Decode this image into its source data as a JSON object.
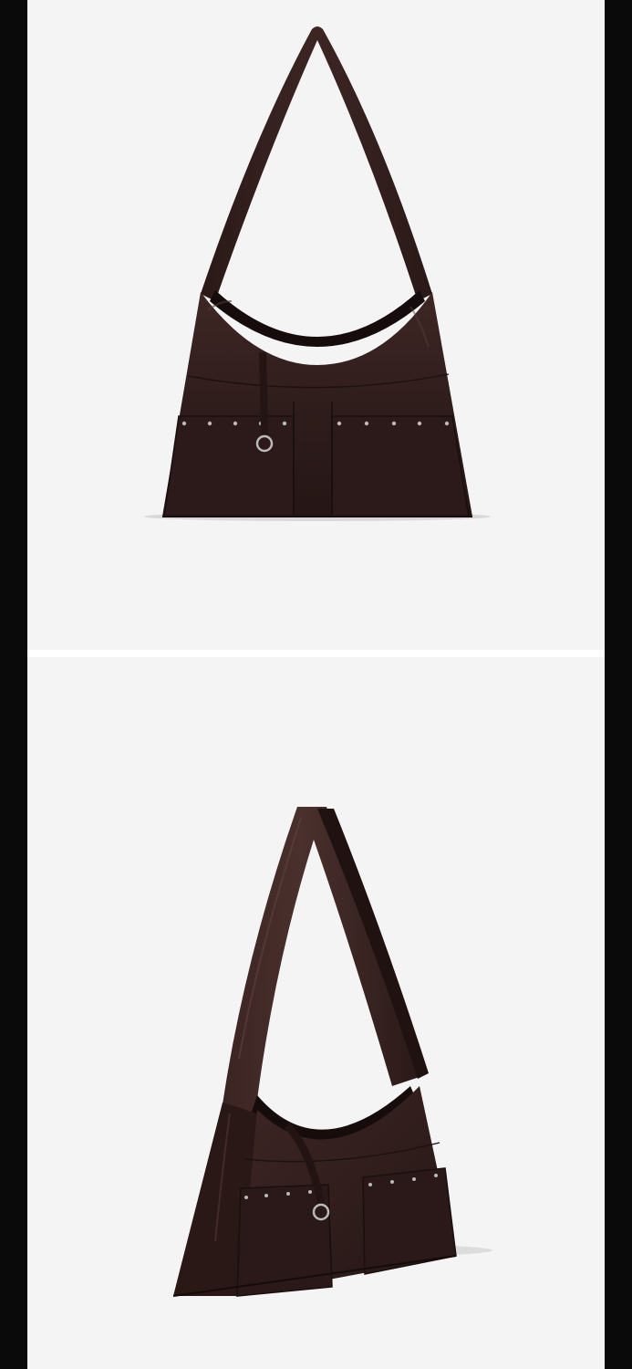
{
  "product": {
    "name_icon": "shoulder-bag",
    "material": "leather",
    "colors": {
      "leather": "#3a2523",
      "leather_dark": "#221514",
      "leather_highlight": "#5a3b38",
      "hardware": "#b9b9b9",
      "background": "#f4f4f4",
      "frame": "#0a0a0a"
    }
  },
  "views": [
    {
      "view": "front"
    },
    {
      "view": "three-quarter"
    }
  ]
}
